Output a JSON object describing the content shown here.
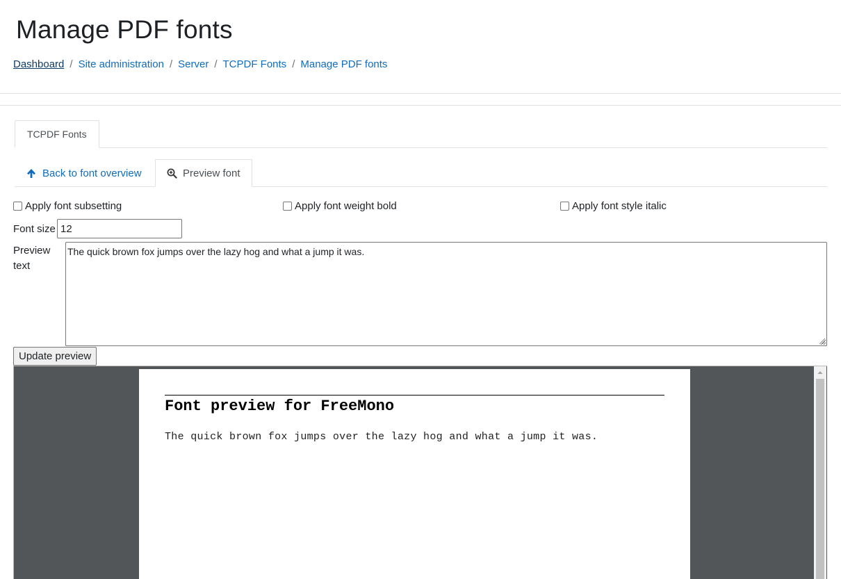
{
  "header": {
    "title": "Manage PDF fonts",
    "breadcrumb": [
      "Dashboard",
      "Site administration",
      "Server",
      "TCPDF Fonts",
      "Manage PDF fonts"
    ],
    "separator": "/"
  },
  "tabs": {
    "primary": "TCPDF Fonts",
    "back": "Back to font overview",
    "preview": "Preview font"
  },
  "form": {
    "subsetting_label": "Apply font subsetting",
    "bold_label": "Apply font weight bold",
    "italic_label": "Apply font style italic",
    "font_size_label": "Font size",
    "font_size_value": "12",
    "preview_text_label": "Preview text",
    "preview_text_value": "The quick brown fox jumps over the lazy hog and what a jump it was.",
    "update_button": "Update preview"
  },
  "pdf": {
    "heading": "Font preview for FreeMono",
    "body": "The quick brown fox jumps over the lazy hog and what a jump it was."
  },
  "colors": {
    "link": "#0f6cbf",
    "viewer_bg": "#525659"
  },
  "icons": {
    "back": "arrow-up-icon",
    "preview": "zoom-in-icon"
  }
}
